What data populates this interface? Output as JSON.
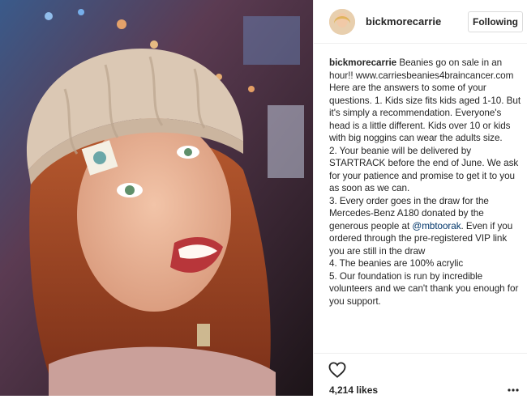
{
  "post": {
    "username": "bickmorecarrie",
    "follow_label": "Following",
    "caption_author": "bickmorecarrie",
    "caption_lines": [
      " Beanies go on sale in an",
      "hour!! www.carriesbeanies4braincancer.com",
      "Here are the answers to some of your",
      "questions. 1. Kids size fits kids aged 1-10. But",
      "it's simply a recommendation. Everyone's",
      "head is a little different. Kids over 10 or kids",
      "with big noggins can wear the adults size.",
      "2. Your beanie will be delivered by",
      "STARTRACK before the end of June. We ask",
      "for your patience and promise to get it to you",
      "as soon as we can.",
      "3. Every order goes in the draw for the",
      "Mercedes-Benz A180 donated by the",
      "generous people at ",
      "ordered through the pre-registered VIP link",
      "you are still in the draw",
      "4. The beanies are 100% acrylic",
      "5. Our foundation is run by incredible",
      "volunteers and we can't thank you enough for",
      "you support."
    ],
    "mention": "@mbtoorak",
    "mention_tail": ". Even if you",
    "likes": "4,214 likes"
  },
  "icons": {
    "like": "heart-outline-icon",
    "more": "more-options-icon"
  },
  "colors": {
    "mention": "#003569",
    "border": "#efefef",
    "text": "#262626"
  }
}
